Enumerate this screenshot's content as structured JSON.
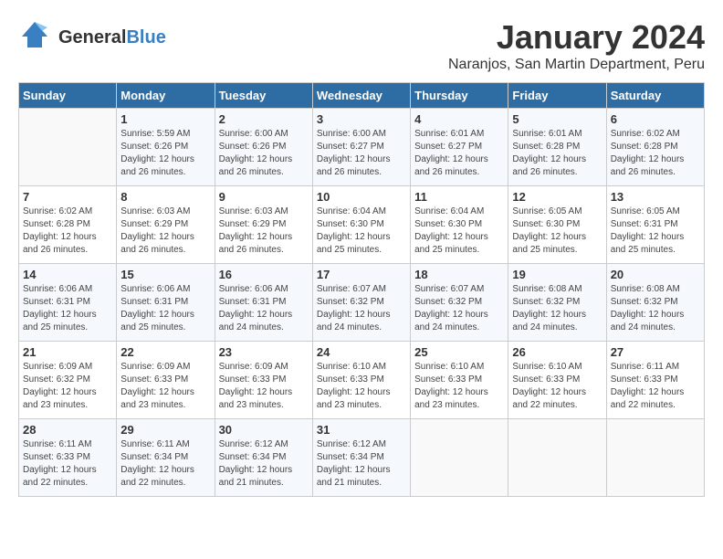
{
  "header": {
    "logo_general": "General",
    "logo_blue": "Blue",
    "month_title": "January 2024",
    "location": "Naranjos, San Martin Department, Peru"
  },
  "days_of_week": [
    "Sunday",
    "Monday",
    "Tuesday",
    "Wednesday",
    "Thursday",
    "Friday",
    "Saturday"
  ],
  "weeks": [
    [
      {
        "day": "",
        "info": ""
      },
      {
        "day": "1",
        "info": "Sunrise: 5:59 AM\nSunset: 6:26 PM\nDaylight: 12 hours\nand 26 minutes."
      },
      {
        "day": "2",
        "info": "Sunrise: 6:00 AM\nSunset: 6:26 PM\nDaylight: 12 hours\nand 26 minutes."
      },
      {
        "day": "3",
        "info": "Sunrise: 6:00 AM\nSunset: 6:27 PM\nDaylight: 12 hours\nand 26 minutes."
      },
      {
        "day": "4",
        "info": "Sunrise: 6:01 AM\nSunset: 6:27 PM\nDaylight: 12 hours\nand 26 minutes."
      },
      {
        "day": "5",
        "info": "Sunrise: 6:01 AM\nSunset: 6:28 PM\nDaylight: 12 hours\nand 26 minutes."
      },
      {
        "day": "6",
        "info": "Sunrise: 6:02 AM\nSunset: 6:28 PM\nDaylight: 12 hours\nand 26 minutes."
      }
    ],
    [
      {
        "day": "7",
        "info": "Sunrise: 6:02 AM\nSunset: 6:28 PM\nDaylight: 12 hours\nand 26 minutes."
      },
      {
        "day": "8",
        "info": "Sunrise: 6:03 AM\nSunset: 6:29 PM\nDaylight: 12 hours\nand 26 minutes."
      },
      {
        "day": "9",
        "info": "Sunrise: 6:03 AM\nSunset: 6:29 PM\nDaylight: 12 hours\nand 26 minutes."
      },
      {
        "day": "10",
        "info": "Sunrise: 6:04 AM\nSunset: 6:30 PM\nDaylight: 12 hours\nand 25 minutes."
      },
      {
        "day": "11",
        "info": "Sunrise: 6:04 AM\nSunset: 6:30 PM\nDaylight: 12 hours\nand 25 minutes."
      },
      {
        "day": "12",
        "info": "Sunrise: 6:05 AM\nSunset: 6:30 PM\nDaylight: 12 hours\nand 25 minutes."
      },
      {
        "day": "13",
        "info": "Sunrise: 6:05 AM\nSunset: 6:31 PM\nDaylight: 12 hours\nand 25 minutes."
      }
    ],
    [
      {
        "day": "14",
        "info": "Sunrise: 6:06 AM\nSunset: 6:31 PM\nDaylight: 12 hours\nand 25 minutes."
      },
      {
        "day": "15",
        "info": "Sunrise: 6:06 AM\nSunset: 6:31 PM\nDaylight: 12 hours\nand 25 minutes."
      },
      {
        "day": "16",
        "info": "Sunrise: 6:06 AM\nSunset: 6:31 PM\nDaylight: 12 hours\nand 24 minutes."
      },
      {
        "day": "17",
        "info": "Sunrise: 6:07 AM\nSunset: 6:32 PM\nDaylight: 12 hours\nand 24 minutes."
      },
      {
        "day": "18",
        "info": "Sunrise: 6:07 AM\nSunset: 6:32 PM\nDaylight: 12 hours\nand 24 minutes."
      },
      {
        "day": "19",
        "info": "Sunrise: 6:08 AM\nSunset: 6:32 PM\nDaylight: 12 hours\nand 24 minutes."
      },
      {
        "day": "20",
        "info": "Sunrise: 6:08 AM\nSunset: 6:32 PM\nDaylight: 12 hours\nand 24 minutes."
      }
    ],
    [
      {
        "day": "21",
        "info": "Sunrise: 6:09 AM\nSunset: 6:32 PM\nDaylight: 12 hours\nand 23 minutes."
      },
      {
        "day": "22",
        "info": "Sunrise: 6:09 AM\nSunset: 6:33 PM\nDaylight: 12 hours\nand 23 minutes."
      },
      {
        "day": "23",
        "info": "Sunrise: 6:09 AM\nSunset: 6:33 PM\nDaylight: 12 hours\nand 23 minutes."
      },
      {
        "day": "24",
        "info": "Sunrise: 6:10 AM\nSunset: 6:33 PM\nDaylight: 12 hours\nand 23 minutes."
      },
      {
        "day": "25",
        "info": "Sunrise: 6:10 AM\nSunset: 6:33 PM\nDaylight: 12 hours\nand 23 minutes."
      },
      {
        "day": "26",
        "info": "Sunrise: 6:10 AM\nSunset: 6:33 PM\nDaylight: 12 hours\nand 22 minutes."
      },
      {
        "day": "27",
        "info": "Sunrise: 6:11 AM\nSunset: 6:33 PM\nDaylight: 12 hours\nand 22 minutes."
      }
    ],
    [
      {
        "day": "28",
        "info": "Sunrise: 6:11 AM\nSunset: 6:33 PM\nDaylight: 12 hours\nand 22 minutes."
      },
      {
        "day": "29",
        "info": "Sunrise: 6:11 AM\nSunset: 6:34 PM\nDaylight: 12 hours\nand 22 minutes."
      },
      {
        "day": "30",
        "info": "Sunrise: 6:12 AM\nSunset: 6:34 PM\nDaylight: 12 hours\nand 21 minutes."
      },
      {
        "day": "31",
        "info": "Sunrise: 6:12 AM\nSunset: 6:34 PM\nDaylight: 12 hours\nand 21 minutes."
      },
      {
        "day": "",
        "info": ""
      },
      {
        "day": "",
        "info": ""
      },
      {
        "day": "",
        "info": ""
      }
    ]
  ]
}
